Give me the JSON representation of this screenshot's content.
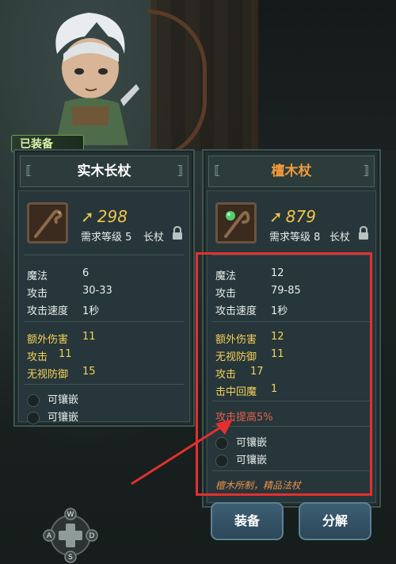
{
  "status": {
    "equipped_tag": "已装备"
  },
  "left_item": {
    "name": "实木长杖",
    "power": "298",
    "required_level": "需求等级 5",
    "type": "长杖",
    "stats": [
      {
        "label": "魔法",
        "value": "6"
      },
      {
        "label": "攻击",
        "value": "30-33"
      },
      {
        "label": "攻击速度",
        "value": "1秒"
      }
    ],
    "bonus_stats": [
      {
        "label": "额外伤害",
        "value": "11"
      },
      {
        "label": "攻击",
        "value": "11"
      },
      {
        "label": "无视防御",
        "value": "15"
      }
    ],
    "sockets": [
      "可镶嵌",
      "可镶嵌"
    ]
  },
  "right_item": {
    "name": "檀木杖",
    "power": "879",
    "required_level": "需求等级 8",
    "type": "长杖",
    "stats": [
      {
        "label": "魔法",
        "value": "12"
      },
      {
        "label": "攻击",
        "value": "79-85"
      },
      {
        "label": "攻击速度",
        "value": "1秒"
      }
    ],
    "bonus_stats": [
      {
        "label": "额外伤害",
        "value": "12"
      },
      {
        "label": "无视防御",
        "value": "11"
      },
      {
        "label": "攻击",
        "value": "17"
      },
      {
        "label": "击中回魔",
        "value": "1"
      }
    ],
    "special": "攻击提高5%",
    "sockets": [
      "可镶嵌",
      "可镶嵌"
    ],
    "description": "檀木所制，精品法杖"
  },
  "actions": {
    "equip_label": "装备",
    "decompose_label": "分解"
  },
  "controls": {
    "up": "W",
    "left": "A",
    "right": "D",
    "down": "S"
  },
  "colors": {
    "name_equipped": "#ffffff",
    "name_compared": "#f29a3b",
    "power": "#f2c54b",
    "bonus_stat": "#f5d258",
    "special": "#e8604d",
    "highlight": "#e3302f"
  },
  "icons": {
    "power": "staff-power-icon",
    "lock": "lock-icon",
    "socket": "empty-socket-icon"
  }
}
